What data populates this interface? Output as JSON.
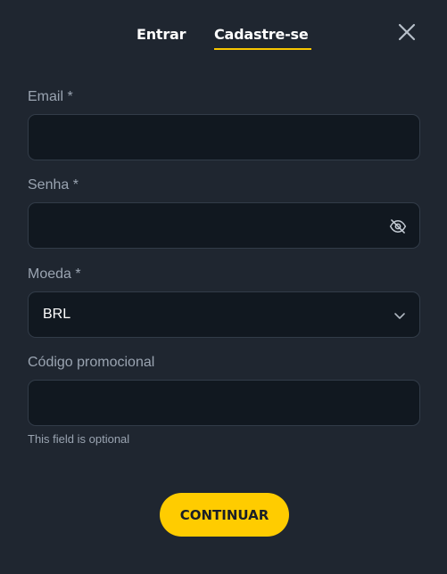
{
  "tabs": {
    "login_label": "Entrar",
    "signup_label": "Cadastre-se",
    "active": "signup"
  },
  "icons": {
    "close": "close-icon",
    "password_toggle": "eye-off-icon",
    "dropdown": "chevron-down-icon"
  },
  "form": {
    "email": {
      "label": "Email *",
      "value": ""
    },
    "password": {
      "label": "Senha *",
      "value": ""
    },
    "currency": {
      "label": "Moeda *",
      "selected": "BRL"
    },
    "promo": {
      "label": "Código promocional",
      "value": "",
      "hint": "This field is optional"
    }
  },
  "actions": {
    "continue_label": "CONTINUAR"
  },
  "colors": {
    "background": "#1f2630",
    "input_background": "#111820",
    "accent": "#ffcc00",
    "label": "#9aa4b1"
  }
}
